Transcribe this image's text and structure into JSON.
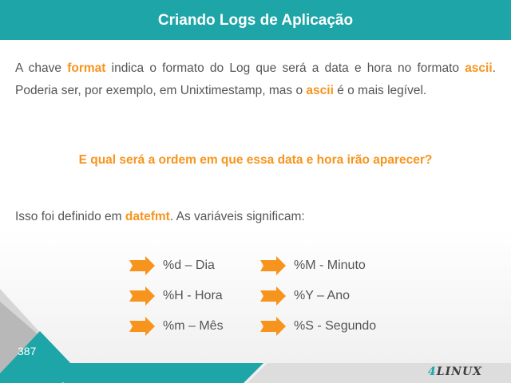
{
  "slide": {
    "title": "Criando Logs de Aplicação",
    "paragraph1": [
      {
        "text": "A chave ",
        "hl": false
      },
      {
        "text": "format",
        "hl": true
      },
      {
        "text": " indica o formato do Log que será a data e hora no formato ",
        "hl": false
      },
      {
        "text": "ascii",
        "hl": true
      },
      {
        "text": ". Poderia ser, por exemplo, em Unixtimestamp, mas o ",
        "hl": false
      },
      {
        "text": "ascii",
        "hl": true
      },
      {
        "text": " é o mais legível.",
        "hl": false
      }
    ],
    "question": "E qual será a ordem em que essa data e hora irão aparecer?",
    "paragraph2": [
      {
        "text": "Isso foi definido em ",
        "hl": false
      },
      {
        "text": "datefmt",
        "hl": true
      },
      {
        "text": ". As variáveis significam:",
        "hl": false
      }
    ],
    "variables": {
      "left": [
        "%d – Dia",
        "%H - Hora",
        "%m – Mês"
      ],
      "right": [
        "%M - Minuto",
        "%Y – Ano",
        "%S - Segundo"
      ]
    },
    "page_number": "387",
    "logo": {
      "digit": "4",
      "word": "LINUX"
    }
  },
  "colors": {
    "teal": "#1ea5a8",
    "orange": "#f7941d",
    "text": "#555555",
    "gray": "#b5b5b5"
  }
}
